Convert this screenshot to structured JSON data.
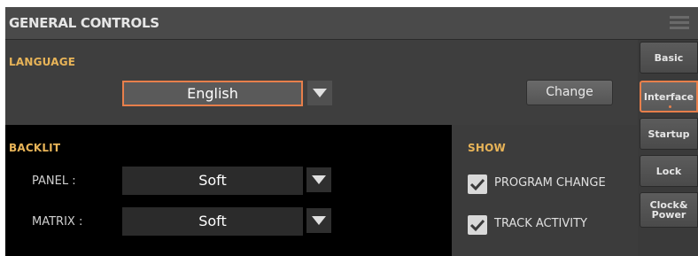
{
  "header": {
    "title": "GENERAL CONTROLS",
    "menu_icon": "hamburger-menu-icon"
  },
  "language": {
    "section_label": "LANGUAGE",
    "selected_value": "English",
    "change_button_label": "Change"
  },
  "backlit": {
    "section_label": "BACKLIT",
    "panel": {
      "label": "PANEL :",
      "value": "Soft"
    },
    "matrix": {
      "label": "MATRIX :",
      "value": "Soft"
    }
  },
  "show": {
    "section_label": "SHOW",
    "options": [
      {
        "label": "PROGRAM CHANGE",
        "checked": true
      },
      {
        "label": "TRACK ACTIVITY",
        "checked": true
      }
    ]
  },
  "tabs": [
    {
      "label": "Basic",
      "active": false
    },
    {
      "label": "Interface",
      "active": true
    },
    {
      "label": "Startup",
      "active": false
    },
    {
      "label": "Lock",
      "active": false
    },
    {
      "label": "Clock& Power",
      "active": false
    }
  ],
  "colors": {
    "accent": "#e77f4b",
    "section_label": "#e8b458",
    "background": "#3c3c3c"
  }
}
